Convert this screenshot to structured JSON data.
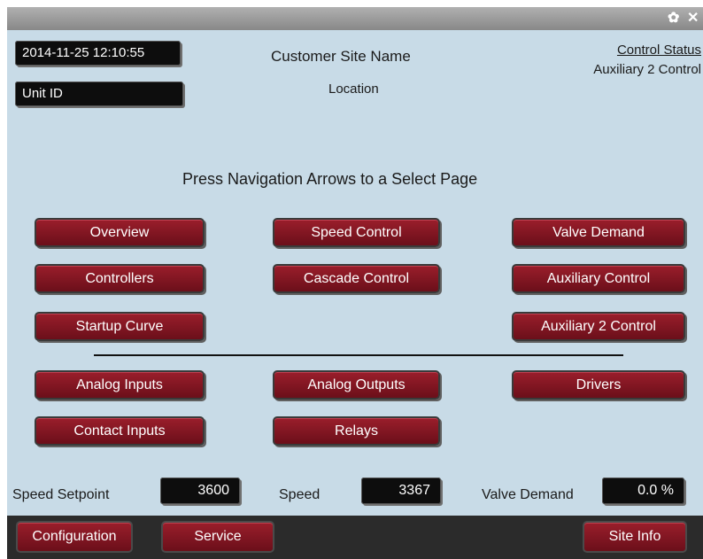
{
  "titlebar": {
    "settings_icon": "gear-icon",
    "close_icon": "close-icon",
    "settings_glyph": "✿",
    "close_glyph": "✕"
  },
  "header": {
    "datetime": "2014-11-25  12:10:55",
    "unit_id": "Unit ID",
    "site_name": "Customer Site Name",
    "location": "Location",
    "control_status_link": "Control Status",
    "control_mode": "Auxiliary 2 Control"
  },
  "instructions": "Press Navigation Arrows to a Select Page",
  "nav": {
    "overview": "Overview",
    "speed_control": "Speed Control",
    "valve_demand": "Valve Demand",
    "controllers": "Controllers",
    "cascade_control": "Cascade Control",
    "auxiliary_control": "Auxiliary Control",
    "startup_curve": "Startup Curve",
    "auxiliary_2_control": "Auxiliary 2 Control",
    "analog_inputs": "Analog Inputs",
    "analog_outputs": "Analog Outputs",
    "drivers": "Drivers",
    "contact_inputs": "Contact Inputs",
    "relays": "Relays"
  },
  "readouts": {
    "speed_setpoint_label": "Speed Setpoint",
    "speed_setpoint_value": "3600",
    "speed_label": "Speed",
    "speed_value": "3367",
    "valve_demand_label": "Valve Demand",
    "valve_demand_value": "0.0 %"
  },
  "footer": {
    "configuration": "Configuration",
    "service": "Service",
    "site_info": "Site Info"
  },
  "colors": {
    "panel_bg": "#c8dbe7",
    "button_red": "#8b1a26",
    "lcd_bg": "#0d0d0d",
    "footer_bg": "#2b2b2b"
  }
}
